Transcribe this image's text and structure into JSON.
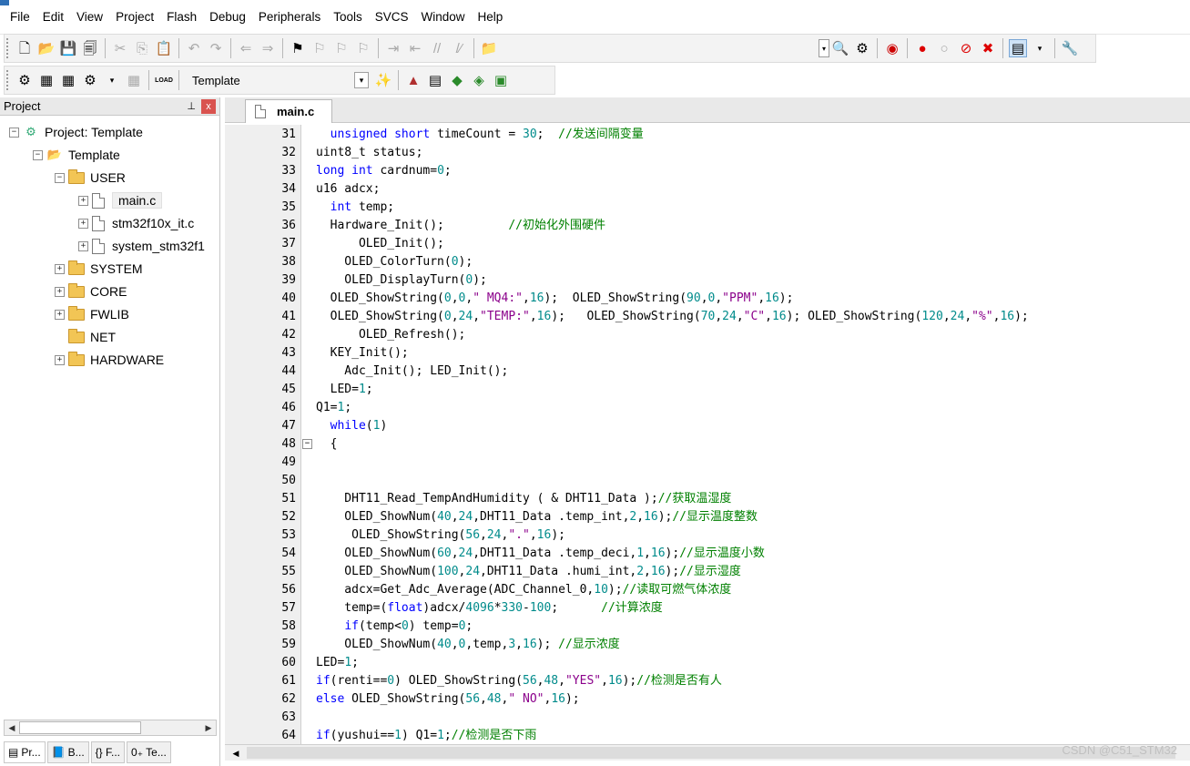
{
  "menu": [
    "File",
    "Edit",
    "View",
    "Project",
    "Flash",
    "Debug",
    "Peripherals",
    "Tools",
    "SVCS",
    "Window",
    "Help"
  ],
  "toolbar2": {
    "target": "Template",
    "load_label": "LOAD"
  },
  "panel": {
    "title": "Project",
    "pin": "ᵖ",
    "close": "x"
  },
  "tree": [
    {
      "label": "Project: Template",
      "level": 0,
      "type": "project",
      "expander": "−"
    },
    {
      "label": "Template",
      "level": 1,
      "type": "target",
      "expander": "−"
    },
    {
      "label": "USER",
      "level": 2,
      "type": "folder",
      "expander": "−"
    },
    {
      "label": "main.c",
      "level": 3,
      "type": "file",
      "expander": "+",
      "selected": true
    },
    {
      "label": "stm32f10x_it.c",
      "level": 3,
      "type": "file",
      "expander": "+"
    },
    {
      "label": "system_stm32f1",
      "level": 3,
      "type": "file",
      "expander": "+"
    },
    {
      "label": "SYSTEM",
      "level": 2,
      "type": "folder",
      "expander": "+"
    },
    {
      "label": "CORE",
      "level": 2,
      "type": "folder",
      "expander": "+"
    },
    {
      "label": "FWLIB",
      "level": 2,
      "type": "folder",
      "expander": "+"
    },
    {
      "label": "NET",
      "level": 2,
      "type": "folder",
      "expander": ""
    },
    {
      "label": "HARDWARE",
      "level": 2,
      "type": "folder",
      "expander": "+"
    }
  ],
  "bottom_tabs": [
    "Pr...",
    "B...",
    "{} F...",
    "0₊ Te..."
  ],
  "editor": {
    "tab": "main.c"
  },
  "code": [
    {
      "n": "31",
      "t": "  unsigned short timeCount = 30;  //发送间隔变量"
    },
    {
      "n": "32",
      "t": "uint8_t status;"
    },
    {
      "n": "33",
      "t": "long int cardnum=0;"
    },
    {
      "n": "34",
      "t": "u16 adcx;"
    },
    {
      "n": "35",
      "t": "  int temp;"
    },
    {
      "n": "36",
      "t": "  Hardware_Init();         //初始化外围硬件"
    },
    {
      "n": "37",
      "t": "      OLED_Init();"
    },
    {
      "n": "38",
      "t": "    OLED_ColorTurn(0);"
    },
    {
      "n": "39",
      "t": "    OLED_DisplayTurn(0);"
    },
    {
      "n": "40",
      "t": "  OLED_ShowString(0,0,\" MQ4:\",16);  OLED_ShowString(90,0,\"PPM\",16);"
    },
    {
      "n": "41",
      "t": "  OLED_ShowString(0,24,\"TEMP:\",16);   OLED_ShowString(70,24,\"C\",16); OLED_ShowString(120,24,\"%\",16);"
    },
    {
      "n": "42",
      "t": "      OLED_Refresh();"
    },
    {
      "n": "43",
      "t": "  KEY_Init();"
    },
    {
      "n": "44",
      "t": "    Adc_Init(); LED_Init();"
    },
    {
      "n": "45",
      "t": "  LED=1;"
    },
    {
      "n": "46",
      "t": "Q1=1;"
    },
    {
      "n": "47",
      "t": "  while(1)"
    },
    {
      "n": "48",
      "t": "  {"
    },
    {
      "n": "49",
      "t": ""
    },
    {
      "n": "50",
      "t": ""
    },
    {
      "n": "51",
      "t": "    DHT11_Read_TempAndHumidity ( & DHT11_Data );//获取温湿度"
    },
    {
      "n": "52",
      "t": "    OLED_ShowNum(40,24,DHT11_Data .temp_int,2,16);//显示温度整数"
    },
    {
      "n": "53",
      "t": "     OLED_ShowString(56,24,\".\",16);"
    },
    {
      "n": "54",
      "t": "    OLED_ShowNum(60,24,DHT11_Data .temp_deci,1,16);//显示温度小数"
    },
    {
      "n": "55",
      "t": "    OLED_ShowNum(100,24,DHT11_Data .humi_int,2,16);//显示湿度"
    },
    {
      "n": "56",
      "t": "    adcx=Get_Adc_Average(ADC_Channel_0,10);//读取可燃气体浓度"
    },
    {
      "n": "57",
      "t": "    temp=(float)adcx/4096*330-100;      //计算浓度"
    },
    {
      "n": "58",
      "t": "    if(temp<0) temp=0;"
    },
    {
      "n": "59",
      "t": "    OLED_ShowNum(40,0,temp,3,16); //显示浓度"
    },
    {
      "n": "60",
      "t": "LED=1;"
    },
    {
      "n": "61",
      "t": "if(renti==0) OLED_ShowString(56,48,\"YES\",16);//检测是否有人"
    },
    {
      "n": "62",
      "t": "else OLED_ShowString(56,48,\" NO\",16);"
    },
    {
      "n": "63",
      "t": ""
    },
    {
      "n": "64",
      "t": "if(yushui==1) Q1=1;//检测是否下雨"
    }
  ],
  "fold_marker": "−",
  "watermark": "CSDN @C51_STM32",
  "colors": {
    "keyword": "#0000ff",
    "number": "#008b8b",
    "string": "#8b008b",
    "comment": "#008000"
  }
}
